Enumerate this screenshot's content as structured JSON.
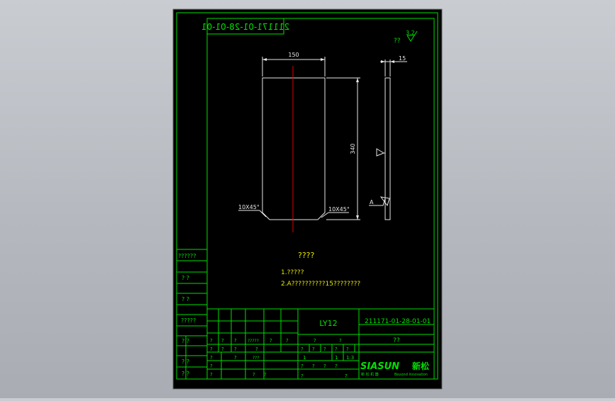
{
  "drawing": {
    "mirrored_code": "211171-01-28-01-01",
    "surface_note": "??",
    "roughness": "3.2",
    "dim_width": "150",
    "dim_thickness": "15",
    "dim_height": "340",
    "chamfer_left": "10X45°",
    "chamfer_right": "10X45°",
    "datum_letter": "A",
    "tech_title": "????",
    "tech_line_1": "1.?????",
    "tech_line_2": "2.A??????????15????????"
  },
  "side_table": {
    "rows": [
      "??????",
      "?   ?",
      "?   ?",
      "?????",
      "?   ?",
      "?   ?",
      "?   ?"
    ]
  },
  "title_block": {
    "material": "LY12",
    "drawing_number": "211171-01-28-01-01",
    "part_name": "??",
    "brand": "SIASUN",
    "brand_cn": "新松",
    "brand_sub_cn": "新 松 机 器",
    "brand_sub_en": "Beyond Innovation",
    "row1": [
      "?",
      "?",
      "?",
      "?????",
      "?",
      "?",
      "?",
      "?"
    ],
    "row2": [
      "?",
      "?",
      "?",
      "?",
      "?",
      "?",
      "?",
      "?"
    ],
    "row3": [
      "?",
      "?",
      "?",
      "?",
      "?",
      "???",
      "?",
      "?",
      "?",
      "?"
    ],
    "row4": [
      "?",
      "?",
      "?",
      "?",
      "?"
    ],
    "weight_labels": [
      "?",
      "?",
      "?",
      "?",
      "?",
      "?",
      "?"
    ],
    "weight_values": [
      "1",
      "1",
      "1:3"
    ],
    "sheet_label": "?"
  },
  "colors": {
    "frame": "#00e000",
    "geometry": "#e8e8e8",
    "centerline": "#e00000",
    "annotation": "#e6e600",
    "paper": "#000000"
  }
}
